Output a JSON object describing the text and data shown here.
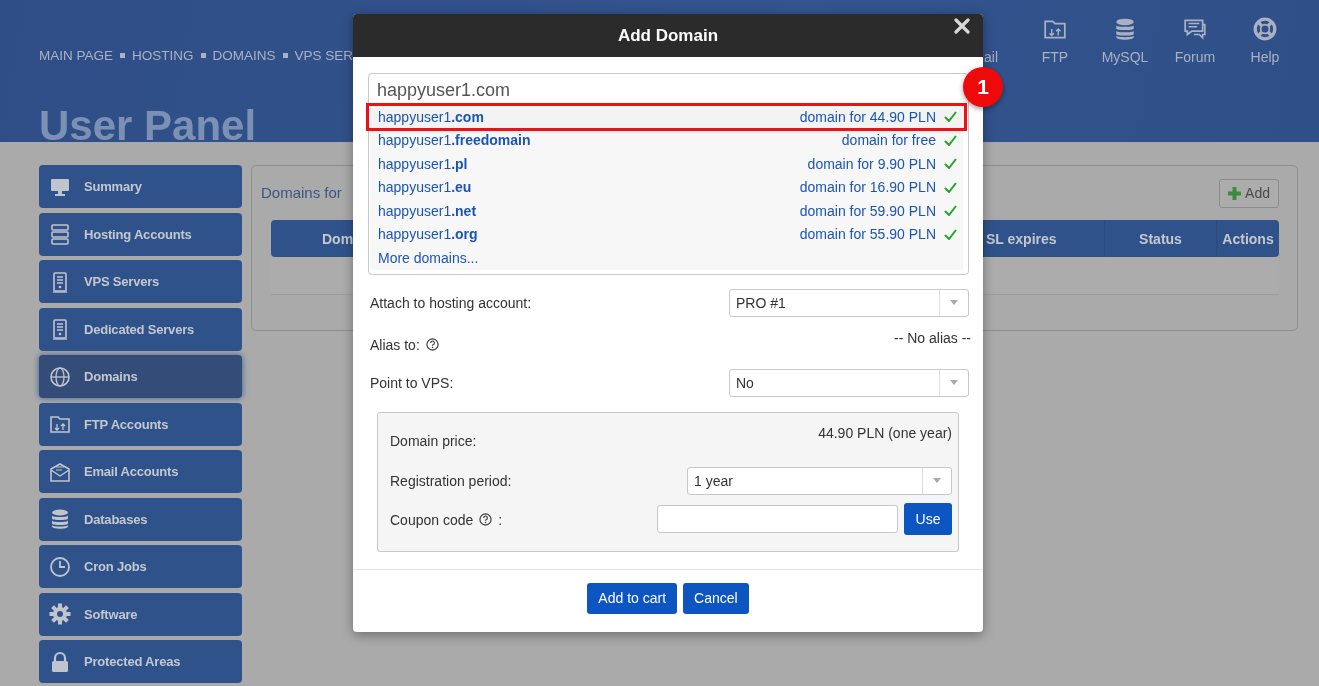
{
  "header": {
    "nav": [
      {
        "label": "MAIN PAGE"
      },
      {
        "label": "HOSTING"
      },
      {
        "label": "DOMAINS"
      },
      {
        "label": "VPS SER"
      }
    ],
    "shortcuts": [
      {
        "label": "ail"
      },
      {
        "label": "FTP"
      },
      {
        "label": "MySQL"
      },
      {
        "label": "Forum"
      },
      {
        "label": "Help"
      }
    ],
    "title": "User Panel"
  },
  "sidebar": {
    "items": [
      {
        "label": "Summary",
        "selected": false
      },
      {
        "label": "Hosting Accounts",
        "selected": false
      },
      {
        "label": "VPS Servers",
        "selected": false
      },
      {
        "label": "Dedicated Servers",
        "selected": false
      },
      {
        "label": "Domains",
        "selected": true
      },
      {
        "label": "FTP Accounts",
        "selected": false
      },
      {
        "label": "Email Accounts",
        "selected": false
      },
      {
        "label": "Databases",
        "selected": false
      },
      {
        "label": "Cron Jobs",
        "selected": false
      },
      {
        "label": "Software",
        "selected": false
      },
      {
        "label": "Protected Areas",
        "selected": false
      }
    ]
  },
  "content": {
    "heading": "Domains for",
    "add_button": "Add",
    "table": {
      "columns": [
        "Dom",
        "SL expires",
        "Status",
        "Actions"
      ]
    }
  },
  "modal": {
    "title": "Add Domain",
    "search": {
      "value": "happyuser1.com"
    },
    "suggestions": [
      {
        "name": "happyuser1**.com**",
        "price": "domain for 44.90 PLN",
        "available": true,
        "highlighted": true
      },
      {
        "name": "happyuser1**.freedomain**",
        "price": "domain for free",
        "available": true,
        "highlighted": false
      },
      {
        "name": "happyuser1**.pl**",
        "price": "domain for 9.90 PLN",
        "available": true,
        "highlighted": false
      },
      {
        "name": "happyuser1**.eu**",
        "price": "domain for 16.90 PLN",
        "available": true,
        "highlighted": false
      },
      {
        "name": "happyuser1**.net**",
        "price": "domain for 59.90 PLN",
        "available": true,
        "highlighted": false
      },
      {
        "name": "happyuser1**.org**",
        "price": "domain for 55.90 PLN",
        "available": true,
        "highlighted": false
      }
    ],
    "more_link": "More domains...",
    "fields": [
      {
        "kind": "select",
        "label": "Attach to hosting account:",
        "help": false,
        "value": "PRO #1"
      },
      {
        "kind": "text",
        "label": "Alias to:",
        "help": true,
        "value": "-- No alias --"
      },
      {
        "kind": "select",
        "label": "Point to VPS:",
        "help": false,
        "value": "No"
      }
    ],
    "price_panel": [
      {
        "kind": "text",
        "label": "Domain price:",
        "help": false,
        "value": "44.90 PLN (one year)"
      },
      {
        "kind": "select",
        "label": "Registration period:",
        "help": false,
        "value": "1 year"
      },
      {
        "kind": "coupon",
        "label": "Coupon code",
        "help": true,
        "suffix": ":",
        "button": "Use"
      }
    ],
    "buttons": [
      "Add to cart",
      "Cancel"
    ]
  },
  "annotation": {
    "number": "1"
  }
}
